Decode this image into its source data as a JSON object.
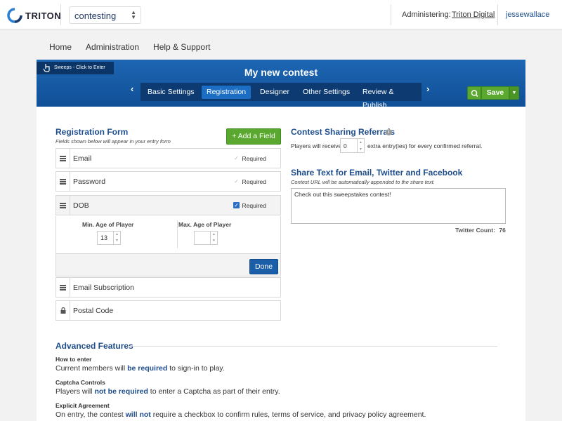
{
  "topbar": {
    "logo_text": "TRITON",
    "app_selector": "contesting",
    "administering_label": "Administering:",
    "administering_value": "Triton Digital",
    "username": "jessewallace"
  },
  "main_nav": [
    "Home",
    "Administration",
    "Help & Support"
  ],
  "contest": {
    "sweeps_label": "Sweeps - Click to Enter",
    "title": "My new contest",
    "tabs": [
      "Basic Settings",
      "Registration",
      "Designer",
      "Other Settings",
      "Review & Publish"
    ],
    "active_tab": "Registration",
    "save_label": "Save"
  },
  "registration": {
    "title": "Registration Form",
    "subtitle": "Fields shown below will appear in your entry form",
    "add_field_label": "+ Add a Field",
    "fields": [
      {
        "label": "Email",
        "required_label": "Required",
        "checked": false
      },
      {
        "label": "Password",
        "required_label": "Required",
        "checked": false
      },
      {
        "label": "DOB",
        "required_label": "Required",
        "checked": true
      },
      {
        "label": "Email Subscription"
      },
      {
        "label": "Postal Code"
      }
    ],
    "dob": {
      "min_age_label": "Min. Age of Player",
      "min_age_value": "13",
      "max_age_label": "Max. Age of Player",
      "max_age_value": "",
      "done_label": "Done"
    }
  },
  "sharing": {
    "title": "Contest Sharing Referrals",
    "info_icon": "i",
    "text_before": "Players will receive",
    "value": "0",
    "text_after": "extra entry(ies) for every confirmed referral."
  },
  "share_text": {
    "title": "Share Text for Email, Twitter and Facebook",
    "subtitle": "Contest URL will be automatically appended to the share text.",
    "value": "Check out this sweepstakes contest!",
    "twitter_count_label": "Twitter Count:",
    "twitter_count": "76"
  },
  "advanced": {
    "title": "Advanced Features",
    "how_to_enter": {
      "heading": "How to enter",
      "pre": "Current members will",
      "highlight": "be required",
      "post": "to sign-in to play."
    },
    "captcha": {
      "heading": "Captcha Controls",
      "pre": "Players will",
      "highlight": "not be required",
      "post": "to enter a Captcha as part of their entry."
    },
    "agreement": {
      "heading": "Explicit Agreement",
      "pre": "On entry, the contest",
      "highlight": "will not",
      "post": "require a checkbox to confirm rules, terms of service, and privacy policy agreement."
    }
  },
  "colors": {
    "header_blue": "#1a5ea8",
    "tab_bar": "#0d3a70",
    "active_tab": "#1c6ec4",
    "green": "#5aa82f",
    "heading_blue": "#1e4d8c"
  }
}
